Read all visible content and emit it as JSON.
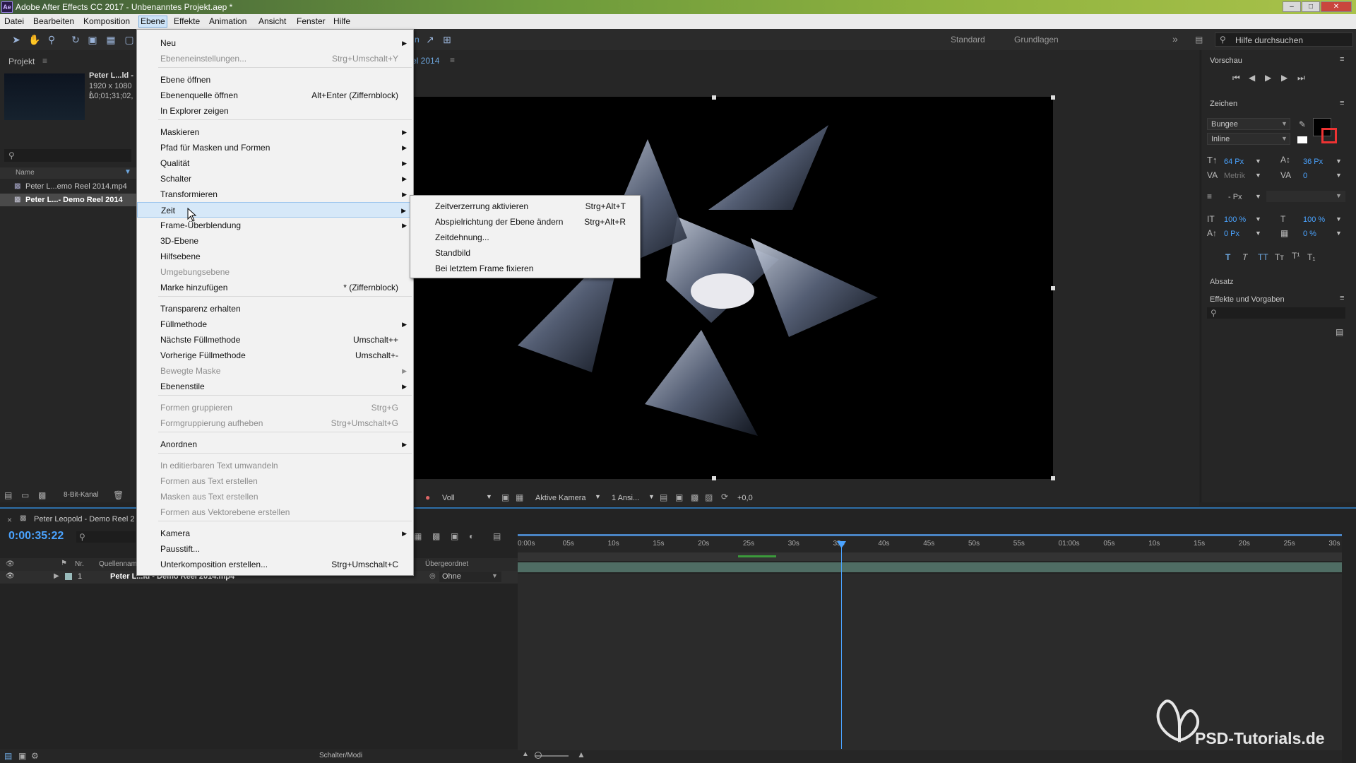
{
  "titlebar": {
    "icon": "Ae",
    "title": "Adobe After Effects CC 2017 - Unbenanntes Projekt.aep *"
  },
  "menubar": [
    {
      "label": "Datei"
    },
    {
      "label": "Bearbeiten"
    },
    {
      "label": "Komposition"
    },
    {
      "label": "Ebene"
    },
    {
      "label": "Effekte"
    },
    {
      "label": "Animation"
    },
    {
      "label": "Ansicht"
    },
    {
      "label": "Fenster"
    },
    {
      "label": "Hilfe"
    }
  ],
  "toolbar": {
    "workspace_standard": "Standard",
    "workspace_grundlagen": "Grundlagen",
    "search_placeholder": "Hilfe durchsuchen",
    "comp_tab_partial": "n",
    "comp_year": "el 2014"
  },
  "project": {
    "title": "Projekt",
    "item_name": "Peter L...ld -",
    "item_size": "1920 x 1080 (",
    "item_duration": "Δ0;01;31;02,",
    "col_name": "Name",
    "files": [
      "Peter L...emo Reel 2014.mp4",
      "Peter L...- Demo Reel 2014"
    ],
    "bitdepth": "8-Bit-Kanal"
  },
  "ebene_menu": [
    {
      "label": "Neu",
      "shortcut": "",
      "submenu": true,
      "disabled": false
    },
    {
      "label": "Ebeneneinstellungen...",
      "shortcut": "Strg+Umschalt+Y",
      "submenu": false,
      "disabled": true
    },
    {
      "label": "Ebene öffnen",
      "shortcut": "",
      "submenu": false,
      "disabled": false
    },
    {
      "label": "Ebenenquelle öffnen",
      "shortcut": "Alt+Enter (Ziffernblock)",
      "submenu": false,
      "disabled": false
    },
    {
      "label": "In Explorer zeigen",
      "shortcut": "",
      "submenu": false,
      "disabled": false
    },
    {
      "label": "Maskieren",
      "shortcut": "",
      "submenu": true,
      "disabled": false
    },
    {
      "label": "Pfad für Masken und Formen",
      "shortcut": "",
      "submenu": true,
      "disabled": false
    },
    {
      "label": "Qualität",
      "shortcut": "",
      "submenu": true,
      "disabled": false
    },
    {
      "label": "Schalter",
      "shortcut": "",
      "submenu": true,
      "disabled": false
    },
    {
      "label": "Transformieren",
      "shortcut": "",
      "submenu": true,
      "disabled": false
    },
    {
      "label": "Zeit",
      "shortcut": "",
      "submenu": true,
      "disabled": false,
      "highlighted": true
    },
    {
      "label": "Frame-Überblendung",
      "shortcut": "",
      "submenu": true,
      "disabled": false
    },
    {
      "label": "3D-Ebene",
      "shortcut": "",
      "submenu": false,
      "disabled": false
    },
    {
      "label": "Hilfsebene",
      "shortcut": "",
      "submenu": false,
      "disabled": false
    },
    {
      "label": "Umgebungsebene",
      "shortcut": "",
      "submenu": false,
      "disabled": true
    },
    {
      "label": "Marke hinzufügen",
      "shortcut": "* (Ziffernblock)",
      "submenu": false,
      "disabled": false
    },
    {
      "label": "Transparenz erhalten",
      "shortcut": "",
      "submenu": false,
      "disabled": false
    },
    {
      "label": "Füllmethode",
      "shortcut": "",
      "submenu": true,
      "disabled": false
    },
    {
      "label": "Nächste Füllmethode",
      "shortcut": "Umschalt++",
      "submenu": false,
      "disabled": false
    },
    {
      "label": "Vorherige Füllmethode",
      "shortcut": "Umschalt+-",
      "submenu": false,
      "disabled": false
    },
    {
      "label": "Bewegte Maske",
      "shortcut": "",
      "submenu": true,
      "disabled": true
    },
    {
      "label": "Ebenenstile",
      "shortcut": "",
      "submenu": true,
      "disabled": false
    },
    {
      "label": "Formen gruppieren",
      "shortcut": "Strg+G",
      "submenu": false,
      "disabled": true
    },
    {
      "label": "Formgruppierung aufheben",
      "shortcut": "Strg+Umschalt+G",
      "submenu": false,
      "disabled": true
    },
    {
      "label": "Anordnen",
      "shortcut": "",
      "submenu": true,
      "disabled": false
    },
    {
      "label": "In editierbaren Text umwandeln",
      "shortcut": "",
      "submenu": false,
      "disabled": true
    },
    {
      "label": "Formen aus Text erstellen",
      "shortcut": "",
      "submenu": false,
      "disabled": true
    },
    {
      "label": "Masken aus Text erstellen",
      "shortcut": "",
      "submenu": false,
      "disabled": true
    },
    {
      "label": "Formen aus Vektorebene erstellen",
      "shortcut": "",
      "submenu": false,
      "disabled": true
    },
    {
      "label": "Kamera",
      "shortcut": "",
      "submenu": true,
      "disabled": false
    },
    {
      "label": "Pausstift...",
      "shortcut": "",
      "submenu": false,
      "disabled": false
    },
    {
      "label": "Unterkomposition erstellen...",
      "shortcut": "Strg+Umschalt+C",
      "submenu": false,
      "disabled": false
    }
  ],
  "zeit_menu": [
    {
      "label": "Zeitverzerrung aktivieren",
      "shortcut": "Strg+Alt+T"
    },
    {
      "label": "Abspielrichtung der Ebene ändern",
      "shortcut": "Strg+Alt+R"
    },
    {
      "label": "Zeitdehnung...",
      "shortcut": ""
    },
    {
      "label": "Standbild",
      "shortcut": ""
    },
    {
      "label": "Bei letztem Frame fixieren",
      "shortcut": ""
    }
  ],
  "viewer": {
    "resolution": "Voll",
    "camera": "Aktive Kamera",
    "views": "1 Ansi...",
    "exposure": "+0,0"
  },
  "right": {
    "preview": "Vorschau",
    "character": "Zeichen",
    "font": "Bungee",
    "style": "Inline",
    "font_size": "64 Px",
    "leading": "36 Px",
    "kerning": "Metrik",
    "tracking": "0",
    "stroke": "- Px",
    "vscale": "100 %",
    "hscale": "100 %",
    "baseline": "0 Px",
    "tsume": "0 %",
    "paragraph": "Absatz",
    "effects": "Effekte und Vorgaben"
  },
  "timeline": {
    "comp_tab": "Peter Leopold - Demo Reel 2",
    "timecode": "0:00:35:22",
    "col_nr": "Nr.",
    "col_source": "Quellenname",
    "col_parent": "Übergeordnet",
    "layer_nr": "1",
    "layer_name": "Peter L...ld - Demo Reel 2014.mp4",
    "layer_parent": "Ohne",
    "footer_toggle": "Schalter/Modi",
    "ruler_labels": [
      "0:00s",
      "05s",
      "10s",
      "15s",
      "20s",
      "25s",
      "30s",
      "35s",
      "40s",
      "45s",
      "50s",
      "55s",
      "01:00s",
      "05s",
      "10s",
      "15s",
      "20s",
      "25s",
      "30s"
    ]
  },
  "watermark": "PSD-Tutorials.de"
}
